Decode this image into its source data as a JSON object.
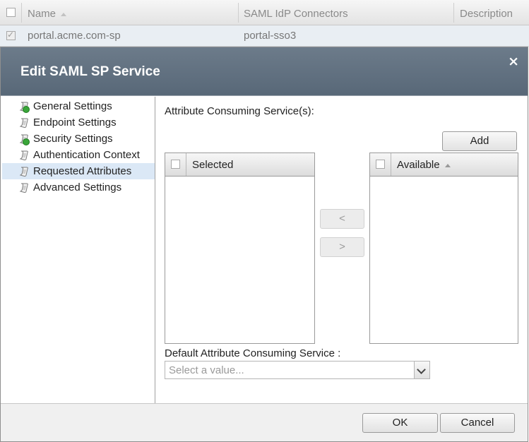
{
  "table": {
    "columns": [
      "Name",
      "SAML IdP Connectors",
      "Description"
    ],
    "row": {
      "name": "portal.acme.com-sp",
      "connector": "portal-sso3",
      "description": ""
    }
  },
  "dialog": {
    "title": "Edit SAML SP Service",
    "close_icon": "×",
    "nav": [
      {
        "label": "General Settings",
        "icon": "scroll-check-icon"
      },
      {
        "label": "Endpoint Settings",
        "icon": "scroll-icon"
      },
      {
        "label": "Security Settings",
        "icon": "scroll-check-icon"
      },
      {
        "label": "Authentication Context",
        "icon": "scroll-icon"
      },
      {
        "label": "Requested Attributes",
        "icon": "scroll-icon",
        "active": true
      },
      {
        "label": "Advanced Settings",
        "icon": "scroll-icon"
      }
    ],
    "content": {
      "acs_label": "Attribute Consuming Service(s):",
      "add_button": "Add",
      "selected_header": "Selected",
      "available_header": "Available",
      "move_left": "<",
      "move_right": ">",
      "default_acs_label": "Default Attribute Consuming Service",
      "default_acs_colon": ":",
      "default_acs_placeholder": "Select a value..."
    },
    "footer": {
      "ok": "OK",
      "cancel": "Cancel"
    }
  },
  "colors": {
    "header_bg": "#586878",
    "active_nav_bg": "#dbe8f6",
    "badge_green": "#3aa63a"
  }
}
